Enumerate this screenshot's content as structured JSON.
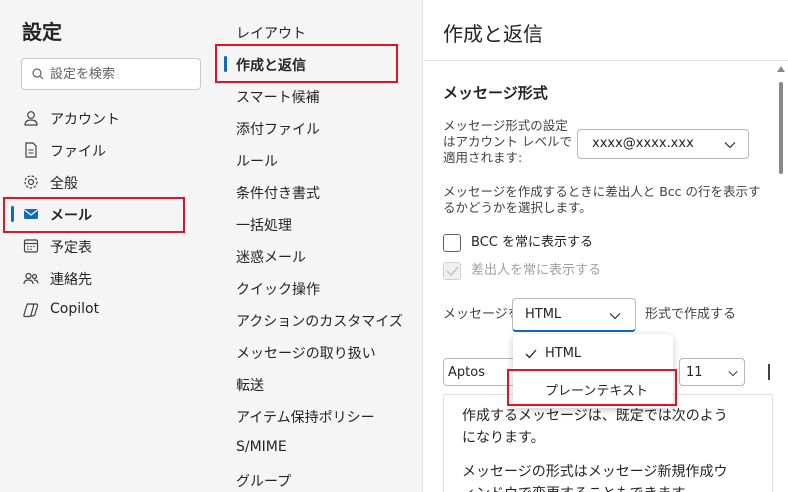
{
  "settings": {
    "title": "設定",
    "search_placeholder": "設定を検索",
    "nav": [
      {
        "label": "アカウント",
        "icon": "person-icon"
      },
      {
        "label": "ファイル",
        "icon": "file-icon"
      },
      {
        "label": "全般",
        "icon": "gear-icon"
      },
      {
        "label": "メール",
        "icon": "mail-icon",
        "active": true
      },
      {
        "label": "予定表",
        "icon": "calendar-icon"
      },
      {
        "label": "連絡先",
        "icon": "people-icon"
      },
      {
        "label": "Copilot",
        "icon": "copilot-icon"
      }
    ]
  },
  "mail_menu": {
    "items": [
      "レイアウト",
      "作成と返信",
      "スマート候補",
      "添付ファイル",
      "ルール",
      "条件付き書式",
      "一括処理",
      "迷惑メール",
      "クイック操作",
      "アクションのカスタマイズ",
      "メッセージの取り扱い",
      "転送",
      "アイテム保持ポリシー",
      "S/MIME",
      "グループ"
    ],
    "active_index": 1
  },
  "pane": {
    "title": "作成と返信",
    "section_title": "メッセージ形式",
    "account_label": "メッセージ形式の設定はアカウント レベルで適用されます:",
    "account_label_lines": [
      "メッセージ形式の設定",
      "はアカウント レベルで",
      "適用されます:"
    ],
    "account_value": "xxxx@xxxx.xxx",
    "bcc_description_lines": [
      "メッセージを作成するときに差出人と Bcc の行を表示す",
      "るかどうかを選択します。"
    ],
    "checkbox_bcc": "BCC を常に表示する",
    "checkbox_from": "差出人を常に表示する",
    "format_prefix": "メッセージを",
    "format_value": "HTML",
    "format_suffix": "形式で作成する",
    "format_options": [
      "HTML",
      "プレーンテキスト"
    ],
    "font_value": "Aptos",
    "size_value": "11",
    "editor_lines": [
      "作成するメッセージは、既定では次のよう",
      "になります。"
    ],
    "editor_line3": "メッセージの形式はメッセージ新規作成ウ",
    "editor_line4": "ィンドウで変更することもできます。"
  },
  "colors": {
    "accent": "#0f6cbd",
    "highlight": "#e81123"
  }
}
